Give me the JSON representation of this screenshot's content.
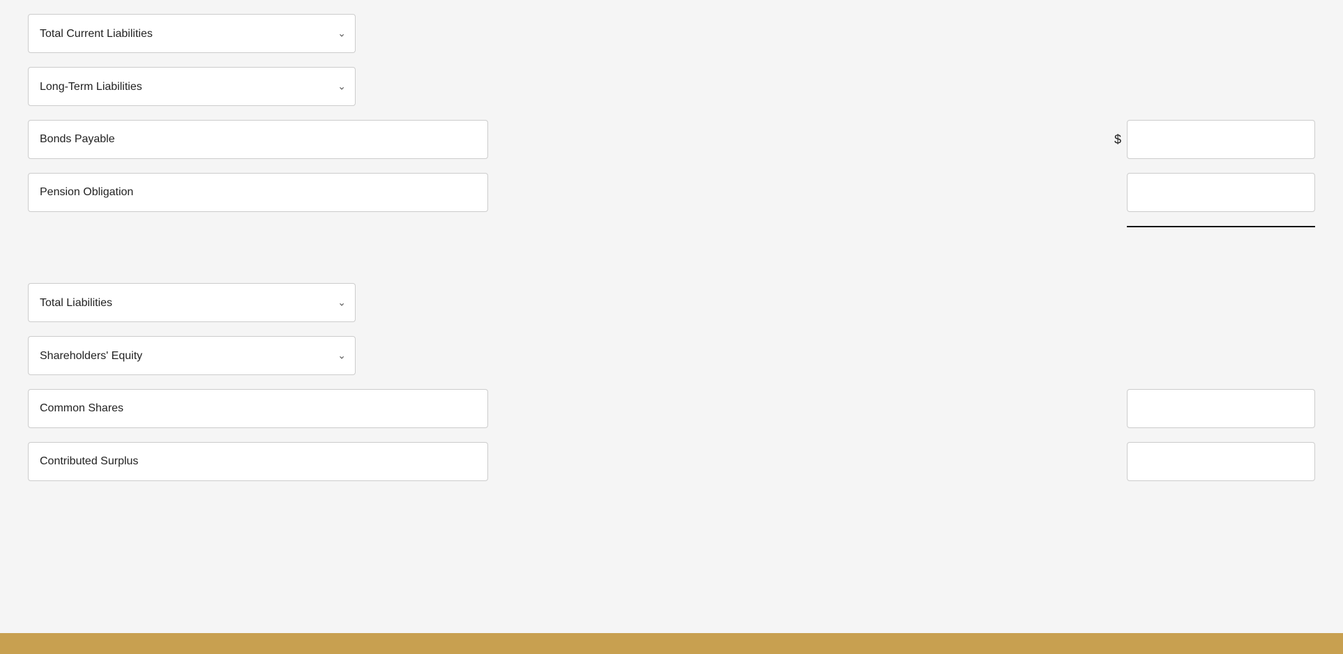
{
  "rows": {
    "total_current_liabilities": {
      "label": "Total Current Liabilities",
      "type": "dropdown"
    },
    "long_term_liabilities": {
      "label": "Long-Term Liabilities",
      "type": "dropdown"
    },
    "bonds_payable": {
      "label": "Bonds Payable",
      "type": "text",
      "show_dollar": true,
      "value": ""
    },
    "pension_obligation": {
      "label": "Pension Obligation",
      "type": "text",
      "show_dollar": false,
      "value": ""
    },
    "total_liabilities": {
      "label": "Total Liabilities",
      "type": "dropdown"
    },
    "shareholders_equity": {
      "label": "Shareholders' Equity",
      "type": "dropdown"
    },
    "common_shares": {
      "label": "Common Shares",
      "type": "text",
      "show_dollar": false,
      "value": ""
    },
    "contributed_surplus": {
      "label": "Contributed Surplus",
      "type": "text",
      "show_dollar": false,
      "value": ""
    }
  },
  "icons": {
    "chevron": "&#8964;"
  }
}
